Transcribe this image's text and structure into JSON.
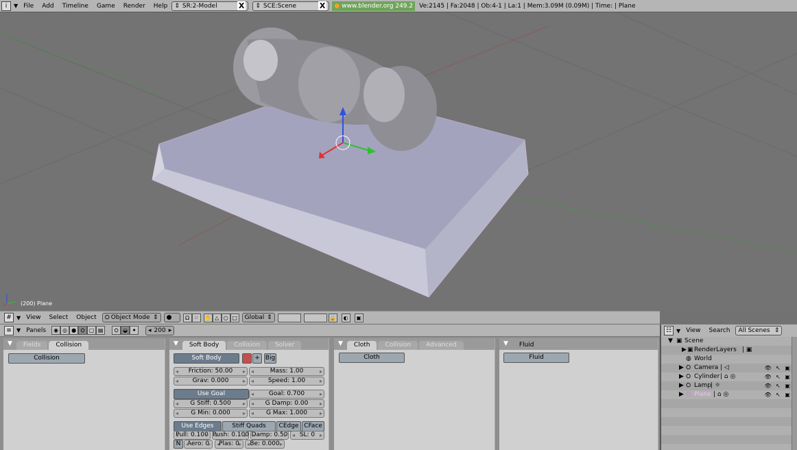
{
  "topbar": {
    "menus": [
      "File",
      "Add",
      "Timeline",
      "Game",
      "Render",
      "Help"
    ],
    "screen_field": "SR:2-Model",
    "scene_field": "SCE:Scene",
    "url": "www.blender.org 249.2",
    "stats": "Ve:2145 | Fa:2048 | Ob:4-1 | La:1  | Mem:3.09M (0.09M)  | Time:  | Plane",
    "close_glyph": "X"
  },
  "viewport": {
    "frame_label": "(200) Plane"
  },
  "view3d_header": {
    "menus": [
      "View",
      "Select",
      "Object"
    ],
    "mode": "Object Mode",
    "orientation": "Global"
  },
  "buttons_header": {
    "panels_label": "Panels",
    "frame": "200"
  },
  "fields_panel": {
    "tabs": [
      "Fields",
      "Collision"
    ],
    "button": "Collision"
  },
  "softbody_panel": {
    "tabs": [
      "Soft Body",
      "Collision",
      "Solver"
    ],
    "softbody_button": "Soft Body",
    "big_button": "Big",
    "friction": "Friction: 50.00",
    "mass": "Mass: 1.00",
    "grav": "Grav: 0.000",
    "speed": "Speed: 1.00",
    "use_goal": "Use Goal",
    "goal": "Goal: 0.700",
    "g_stiff": "G Stiff: 0.500",
    "g_damp": "G Damp: 0.00",
    "g_min": "G Min: 0.000",
    "g_max": "G Max: 1.000",
    "use_edges": "Use Edges",
    "stiff_quads": "Stiff Quads",
    "cedge": "CEdge",
    "cface": "CFace",
    "pull": "Pull: 0.100",
    "push": "Push: 0.100",
    "damp": "Damp: 0.50",
    "sl": "SL: 0",
    "n": "N",
    "aero": "Aero: 0",
    "plas": "Plas: 0",
    "be": "Be: 0.000"
  },
  "cloth_panel": {
    "tabs": [
      "Cloth",
      "Collision",
      "Advanced"
    ],
    "button": "Cloth"
  },
  "fluid_panel": {
    "tabs": [
      "Fluid"
    ],
    "button": "Fluid"
  },
  "outliner": {
    "menus": [
      "View",
      "Search"
    ],
    "filter": "All Scenes",
    "items": [
      "Scene",
      "RenderLayers",
      "World",
      "Camera",
      "Cylinder",
      "Lamp",
      "Plane"
    ]
  }
}
